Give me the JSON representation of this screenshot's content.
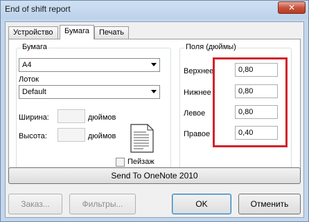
{
  "window": {
    "title": "End of shift report",
    "close_glyph": "✕",
    "close_icon": "close-icon"
  },
  "tabs": [
    {
      "label": "Устройство",
      "active": false
    },
    {
      "label": "Бумага",
      "active": true
    },
    {
      "label": "Печать",
      "active": false
    }
  ],
  "paper": {
    "group_title": "Бумага",
    "size_value": "A4",
    "tray_label": "Лоток",
    "tray_value": "Default",
    "width_label": "Ширина:",
    "width_value": "",
    "width_unit": "дюймов",
    "height_label": "Высота:",
    "height_value": "",
    "height_unit": "дюймов",
    "landscape_label": "Пейзаж",
    "landscape_checked": false,
    "paper_icon": "paper-sheet-icon"
  },
  "margins": {
    "group_title": "Поля (дюймы)",
    "top_label": "Верхнее",
    "top_value": "0,80",
    "bottom_label": "Нижнее",
    "bottom_value": "0,80",
    "left_label": "Левое",
    "left_value": "0,80",
    "right_label": "Правое",
    "right_value": "0,40",
    "highlight_color": "#d2232a"
  },
  "onenote_button": "Send To OneNote 2010",
  "footer": {
    "order_button": "Заказ...",
    "filters_button": "Фильтры...",
    "ok_button": "OK",
    "cancel_button": "Отменить"
  },
  "colors": {
    "frame": "#c3d6ec",
    "close": "#c7533d",
    "highlight": "#d2232a"
  }
}
